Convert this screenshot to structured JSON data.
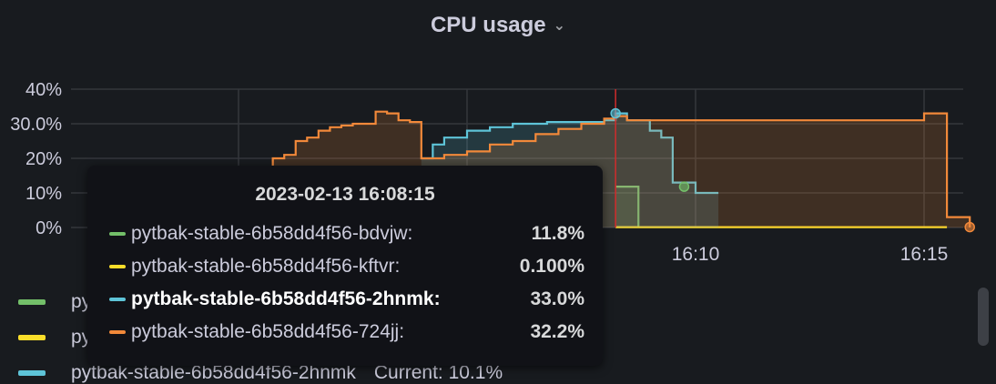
{
  "panel": {
    "title": "CPU usage",
    "menu_icon": "chevron-down-icon"
  },
  "chart_data": {
    "type": "area",
    "y_ticks": [
      "40%",
      "30.0%",
      "20%",
      "10%",
      "0%"
    ],
    "x_ticks": [
      "16:10",
      "16:15"
    ],
    "ylim": [
      0,
      40
    ],
    "grid": true,
    "series": [
      {
        "name": "pytbak-stable-6b58dd4f56-bdvjw",
        "color": "#73bf69",
        "points": [
          [
            "16:08:15",
            11.8
          ],
          [
            "16:08:40",
            11.8
          ],
          [
            "16:08:45",
            0
          ]
        ]
      },
      {
        "name": "pytbak-stable-6b58dd4f56-kftvr",
        "color": "#fade2a",
        "points": [
          [
            "16:08:15",
            0.1
          ],
          [
            "16:15:30",
            0.1
          ]
        ]
      },
      {
        "name": "pytbak-stable-6b58dd4f56-2hnmk",
        "color": "#5ec4d8",
        "points": [
          [
            "16:04:00",
            20
          ],
          [
            "16:04:15",
            24
          ],
          [
            "16:04:30",
            26
          ],
          [
            "16:04:45",
            26
          ],
          [
            "16:05:00",
            28
          ],
          [
            "16:05:15",
            28
          ],
          [
            "16:05:30",
            29
          ],
          [
            "16:05:45",
            29
          ],
          [
            "16:06:00",
            30
          ],
          [
            "16:06:15",
            30
          ],
          [
            "16:06:30",
            30
          ],
          [
            "16:06:45",
            30.5
          ],
          [
            "16:07:00",
            30.5
          ],
          [
            "16:07:15",
            30.5
          ],
          [
            "16:07:30",
            30.5
          ],
          [
            "16:07:45",
            30.5
          ],
          [
            "16:08:00",
            31
          ],
          [
            "16:08:15",
            33.0
          ],
          [
            "16:08:30",
            31
          ],
          [
            "16:08:45",
            31
          ],
          [
            "16:09:00",
            28
          ],
          [
            "16:09:15",
            26
          ],
          [
            "16:09:30",
            13
          ],
          [
            "16:09:45",
            13
          ],
          [
            "16:10:00",
            10
          ],
          [
            "16:10:30",
            10
          ]
        ]
      },
      {
        "name": "pytbak-stable-6b58dd4f56-724jj",
        "color": "#f2893a",
        "points": [
          [
            "15:59:00",
            0
          ],
          [
            "16:00:30",
            0
          ],
          [
            "16:00:45",
            20
          ],
          [
            "16:01:00",
            21
          ],
          [
            "16:01:15",
            25
          ],
          [
            "16:01:30",
            26
          ],
          [
            "16:01:45",
            28
          ],
          [
            "16:02:00",
            29
          ],
          [
            "16:02:15",
            29.5
          ],
          [
            "16:02:30",
            30
          ],
          [
            "16:02:45",
            30
          ],
          [
            "16:03:00",
            33.5
          ],
          [
            "16:03:15",
            33
          ],
          [
            "16:03:30",
            31
          ],
          [
            "16:03:45",
            30.5
          ],
          [
            "16:04:00",
            20
          ],
          [
            "16:04:15",
            20
          ],
          [
            "16:04:30",
            21
          ],
          [
            "16:05:00",
            22
          ],
          [
            "16:05:30",
            24
          ],
          [
            "16:06:00",
            25
          ],
          [
            "16:06:30",
            27
          ],
          [
            "16:07:00",
            28.5
          ],
          [
            "16:07:30",
            30
          ],
          [
            "16:08:00",
            31.5
          ],
          [
            "16:08:15",
            32.2
          ],
          [
            "16:08:30",
            31
          ],
          [
            "16:15:00",
            33
          ],
          [
            "16:15:15",
            33
          ],
          [
            "16:15:30",
            3
          ],
          [
            "16:15:45",
            3
          ],
          [
            "16:16:00",
            0
          ]
        ]
      }
    ],
    "cursor_time": "16:08:15",
    "hover_points": [
      {
        "series": "pytbak-stable-6b58dd4f56-2hnmk",
        "t": "16:08:15",
        "v": 33.0
      },
      {
        "series": "pytbak-stable-6b58dd4f56-bdvjw",
        "t": "16:09:45",
        "v": 11.8
      },
      {
        "series": "pytbak-stable-6b58dd4f56-724jj",
        "t": "16:16:00",
        "v": 0.1
      }
    ]
  },
  "tooltip": {
    "time": "2023-02-13 16:08:15",
    "rows": [
      {
        "name": "pytbak-stable-6b58dd4f56-bdvjw:",
        "value": "11.8%",
        "color": "#73bf69",
        "highlight": false
      },
      {
        "name": "pytbak-stable-6b58dd4f56-kftvr:",
        "value": "0.100%",
        "color": "#fade2a",
        "highlight": false
      },
      {
        "name": "pytbak-stable-6b58dd4f56-2hnmk:",
        "value": "33.0%",
        "color": "#5ec4d8",
        "highlight": true
      },
      {
        "name": "pytbak-stable-6b58dd4f56-724jj:",
        "value": "32.2%",
        "color": "#f2893a",
        "highlight": false
      }
    ]
  },
  "legend": {
    "items": [
      {
        "label": "py",
        "current": "",
        "color": "#73bf69"
      },
      {
        "label": "py",
        "current": "",
        "color": "#fade2a"
      },
      {
        "label": "pytbak-stable-6b58dd4f56-2hnmk",
        "current": "Current: 10.1%",
        "color": "#5ec4d8"
      }
    ]
  }
}
